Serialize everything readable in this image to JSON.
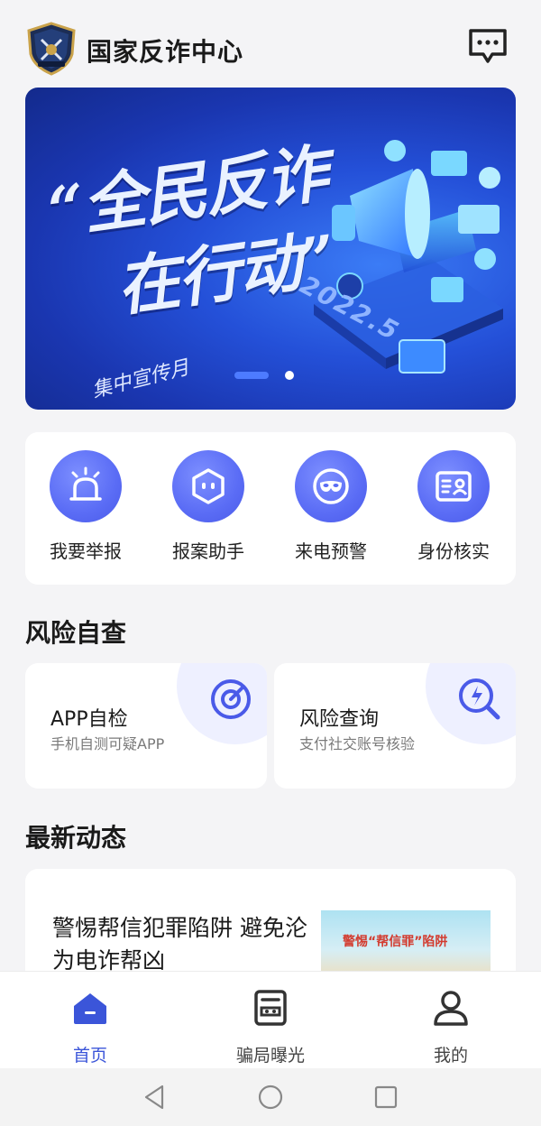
{
  "header": {
    "title": "国家反诈中心",
    "logo_icon": "police-badge-icon",
    "message_icon": "message-icon"
  },
  "banner": {
    "line1": "“全民反诈",
    "line2": "在行动”",
    "sub": "集中宣传月",
    "year": "2022.5",
    "slides_total": 2,
    "active_slide": 1
  },
  "quick_actions": [
    {
      "label": "我要举报",
      "icon": "alarm-siren-icon"
    },
    {
      "label": "报案助手",
      "icon": "assistant-robot-icon"
    },
    {
      "label": "来电预警",
      "icon": "call-warning-mask-icon"
    },
    {
      "label": "身份核实",
      "icon": "id-card-icon"
    }
  ],
  "risk_section": {
    "title": "风险自查",
    "cards": [
      {
        "title": "APP自检",
        "subtitle": "手机自测可疑APP",
        "icon": "target-scan-icon"
      },
      {
        "title": "风险查询",
        "subtitle": "支付社交账号核验",
        "icon": "search-bolt-icon"
      }
    ]
  },
  "news_section": {
    "title": "最新动态",
    "items": [
      {
        "title": "警惕帮信犯罪陷阱 避免沦为电诈帮凶",
        "thumb_text": "警惕“帮信罪”陷阱"
      }
    ]
  },
  "tabbar": [
    {
      "label": "首页",
      "icon": "home-icon",
      "active": true
    },
    {
      "label": "骗局曝光",
      "icon": "exposure-news-icon",
      "active": false
    },
    {
      "label": "我的",
      "icon": "user-icon",
      "active": false
    }
  ],
  "colors": {
    "accent": "#3b55d9",
    "icon_bg": "#5a6cf5",
    "background": "#f4f4f6"
  }
}
